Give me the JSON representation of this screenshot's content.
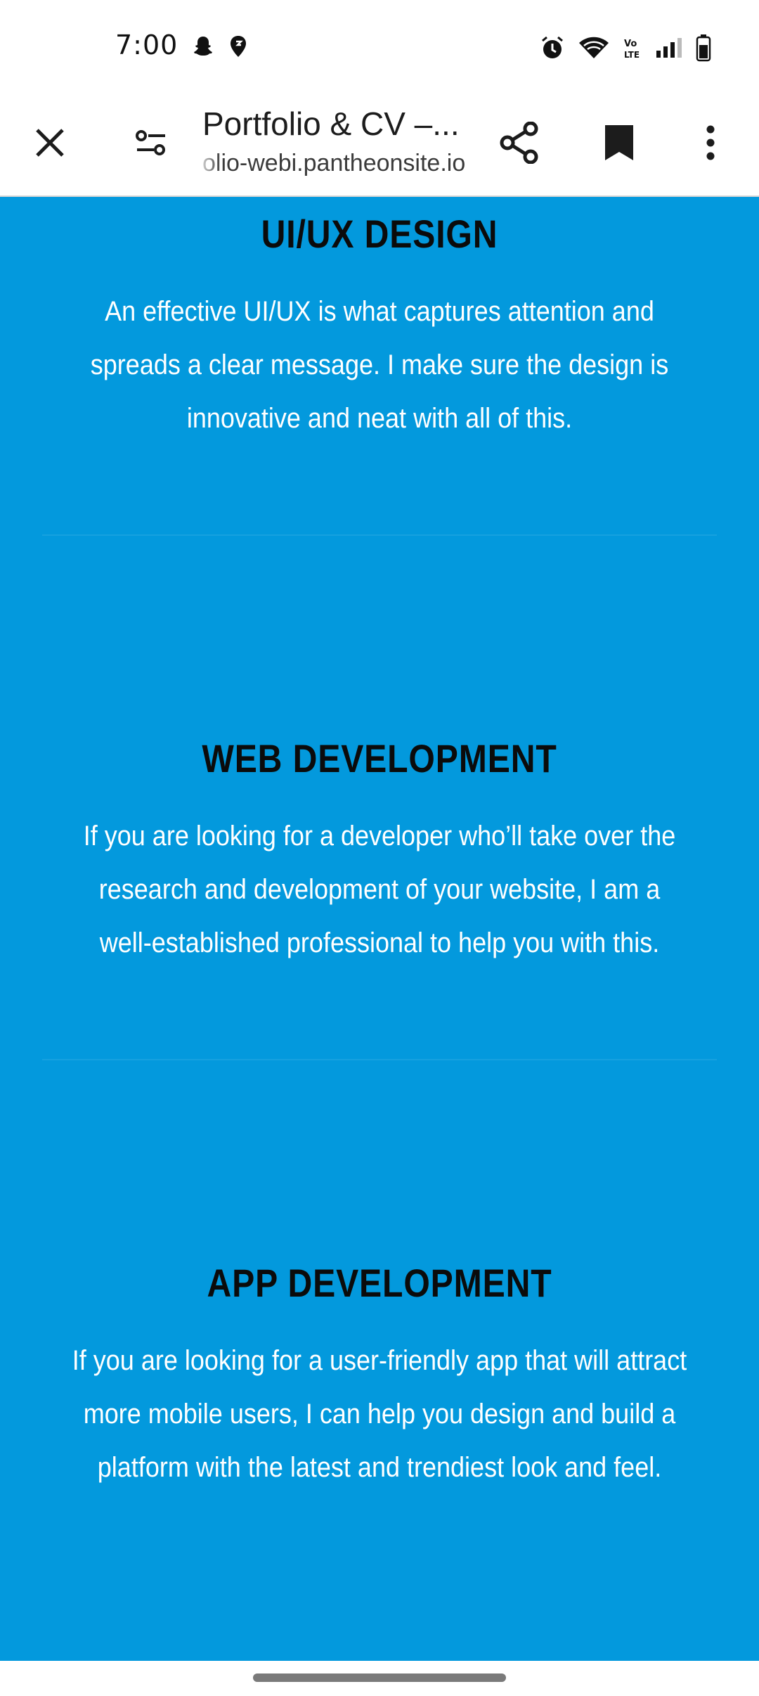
{
  "status_bar": {
    "time": "7:00",
    "left_icons": [
      "snapchat-icon",
      "location-icon"
    ],
    "right_icons": [
      "alarm-icon",
      "wifi-icon",
      "volte-icon",
      "signal-icon",
      "battery-icon"
    ],
    "volte_label": "Vo LTE"
  },
  "browser": {
    "page_title": "Portfolio & CV –...",
    "url": "olio-webi.pantheonsite.io"
  },
  "services": [
    {
      "title": "UI/UX DESIGN",
      "description": "An effective UI/UX is what captures attention and spreads a clear message. I make sure the design is innovative and neat with all of this."
    },
    {
      "title": "WEB DEVELOPMENT",
      "description": "If you are looking for a developer who’ll take over the research and development of your website, I am a well-established professional to help you with this."
    },
    {
      "title": "APP DEVELOPMENT",
      "description": "If you are looking for a user-friendly app that will attract more mobile users, I can help you design and build a platform with the latest and trendiest look and feel."
    }
  ],
  "colors": {
    "page_background": "#0399dd",
    "heading": "#0b0b0b",
    "body_text": "#ffffff",
    "toolbar": "#ffffff"
  }
}
